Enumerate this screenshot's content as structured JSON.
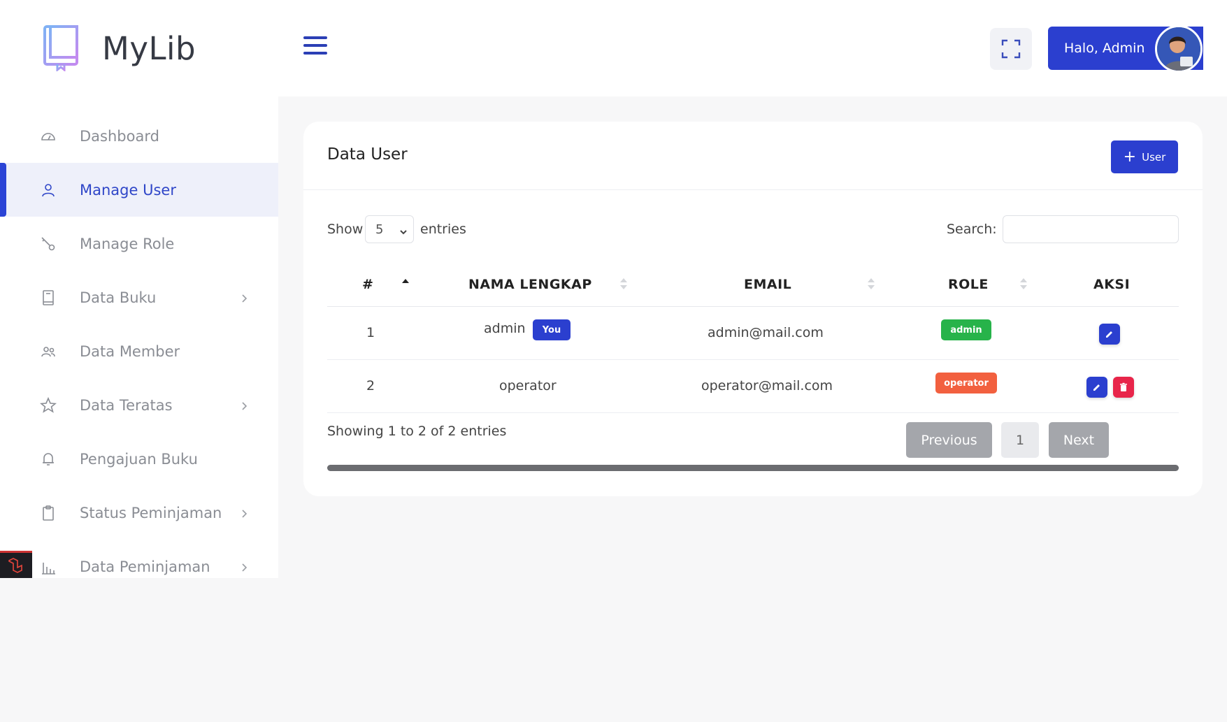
{
  "brand": {
    "name": "MyLib"
  },
  "sidebar": {
    "items": [
      {
        "label": "Dashboard",
        "icon": "gauge-icon",
        "chevron": false,
        "active": false
      },
      {
        "label": "Manage User",
        "icon": "user-icon",
        "chevron": false,
        "active": true
      },
      {
        "label": "Manage Role",
        "icon": "key-icon",
        "chevron": false,
        "active": false
      },
      {
        "label": "Data Buku",
        "icon": "book-icon",
        "chevron": true,
        "active": false
      },
      {
        "label": "Data Member",
        "icon": "users-icon",
        "chevron": false,
        "active": false
      },
      {
        "label": "Data Teratas",
        "icon": "star-icon",
        "chevron": true,
        "active": false
      },
      {
        "label": "Pengajuan Buku",
        "icon": "bell-icon",
        "chevron": false,
        "active": false
      },
      {
        "label": "Status Peminjaman",
        "icon": "clipboard-icon",
        "chevron": true,
        "active": false
      },
      {
        "label": "Data Peminjaman",
        "icon": "bar-chart-icon",
        "chevron": true,
        "active": false
      }
    ]
  },
  "header": {
    "greeting": "Halo, Admin"
  },
  "card": {
    "title": "Data User",
    "add_button_label": "User",
    "show_label": "Show",
    "entries_value": "5",
    "entries_label": "entries",
    "search_label": "Search:",
    "search_value": "",
    "columns": [
      "#",
      "NAMA LENGKAP",
      "EMAIL",
      "ROLE",
      "AKSI"
    ],
    "rows": [
      {
        "no": "1",
        "name": "admin",
        "you_badge": "You",
        "email": "admin@mail.com",
        "role": "admin",
        "role_color": "#27b34a",
        "can_delete": false
      },
      {
        "no": "2",
        "name": "operator",
        "you_badge": "",
        "email": "operator@mail.com",
        "role": "operator",
        "role_color": "#f2603f",
        "can_delete": true
      }
    ],
    "info": "Showing 1 to 2 of 2 entries",
    "pager": {
      "previous": "Previous",
      "page": "1",
      "next": "Next"
    }
  },
  "colors": {
    "primary": "#2b3fcf",
    "danger": "#e8254a",
    "success": "#27b34a",
    "warning": "#f2603f"
  }
}
